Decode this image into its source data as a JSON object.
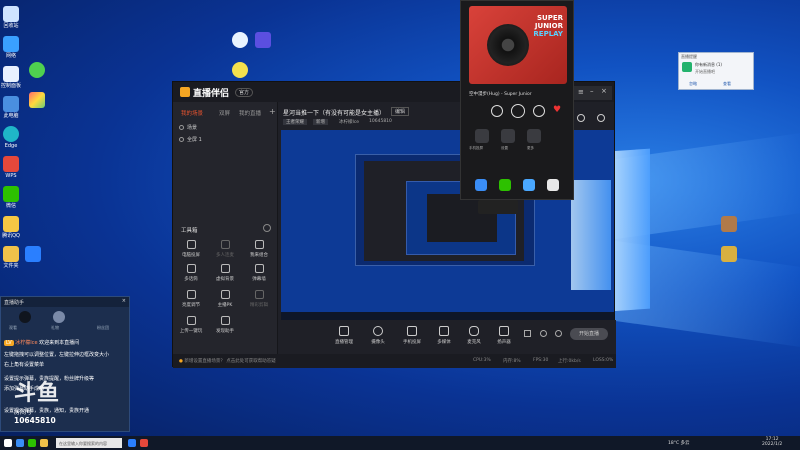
{
  "app": {
    "name": "直播伴侣",
    "version": "官方",
    "tabs": [
      "我的场景",
      "双屏",
      "我的直播"
    ],
    "scenes": [
      "场景",
      "全屏 1"
    ],
    "tools_label": "工具箱",
    "tools": [
      {
        "label": "电脑投屏",
        "dim": false
      },
      {
        "label": "多人连麦",
        "dim": true
      },
      {
        "label": "我来组合",
        "dim": false
      },
      {
        "label": "多话筒",
        "dim": false
      },
      {
        "label": "虚拟背景",
        "dim": false
      },
      {
        "label": "弹幕墙",
        "dim": false
      },
      {
        "label": "亮度调节",
        "dim": false
      },
      {
        "label": "主播PK",
        "dim": false
      },
      {
        "label": "精彩剪辑",
        "dim": true
      },
      {
        "label": "上传一键玩",
        "dim": false
      },
      {
        "label": "发现助手",
        "dim": false
      }
    ],
    "room_title": "星河当推一下（有没有可能是女主播）",
    "edit_label": "编辑",
    "category": "王者荣耀",
    "category2": "新增",
    "anchor": "冰柠檬Ice",
    "room_id": "10645810",
    "bottom_tools": [
      "直播管理",
      "摄像头",
      "手机投屏",
      "多媒体",
      "麦克风",
      "扬声器"
    ],
    "start_button": "开始直播",
    "status_text": "新增设置直播场景？ 点击此处可获取帮助答疑",
    "stats": [
      "CPU:3%",
      "内存:8%",
      "FPS:30",
      "上行:0kb/s",
      "LOSS:0%"
    ]
  },
  "phone": {
    "album_title1": "SUPER",
    "album_title2": "JUNIOR",
    "album_title3": "REPLAY",
    "song": "空中漫步(Hug) - Super Junior",
    "apps": [
      "手机投屏",
      "设置",
      "更多"
    ]
  },
  "popup": {
    "title": "直播提醒",
    "line1": "你有新消息 (1)",
    "line2": "开始直播吧",
    "btn1": "忽略",
    "btn2": "查看"
  },
  "chat": {
    "title": "直播助手",
    "tabs": [
      "观看",
      "礼物",
      "粉丝团"
    ],
    "welcome_user": "冰柠檬Ice",
    "welcome": "欢迎来到本直播间",
    "lines": [
      "左键拖拽可以调整位置，左键拉伸边框改变大小",
      "右上角有设置菜单",
      "设置提示弹幕，贵族提醒，粉丝牌升级等",
      "添加弹幕助手成功",
      "设置提示弹幕，贵族，通知，贵族开通"
    ]
  },
  "watermark": {
    "brand": "斗鱼",
    "room_label": "房间号",
    "room_number": "10645810"
  },
  "desktop_icons": [
    {
      "label": "回收站"
    },
    {
      "label": "网络"
    },
    {
      "label": "控制面板"
    },
    {
      "label": "此电脑"
    },
    {
      "label": "Edge"
    },
    {
      "label": "WPS"
    },
    {
      "label": "微信"
    },
    {
      "label": "腾讯QQ"
    },
    {
      "label": "文件夹"
    },
    {
      "label": "直播伴侣"
    }
  ],
  "taskbar": {
    "search_placeholder": "在这里输入你要搜索的内容",
    "weather": "18°C 多云",
    "time": "17:12",
    "date": "2022/1/2"
  }
}
